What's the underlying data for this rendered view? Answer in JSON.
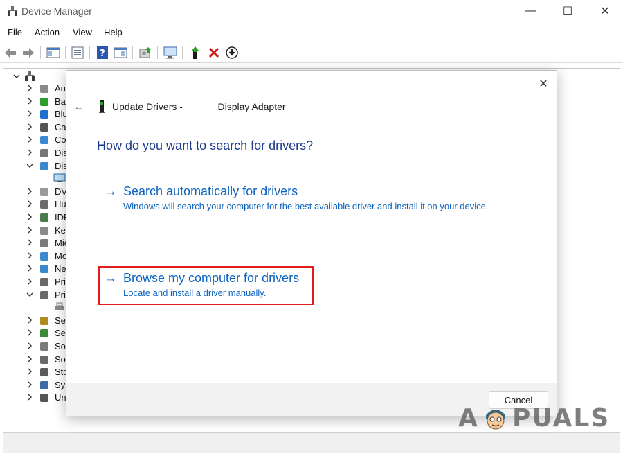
{
  "window": {
    "title": "Device Manager",
    "minimize_glyph": "—",
    "maximize_glyph": "☐",
    "close_glyph": "✕"
  },
  "menu": {
    "items": [
      "File",
      "Action",
      "View",
      "Help"
    ]
  },
  "toolbar": {
    "icons": [
      "back-arrow-icon",
      "forward-arrow-icon",
      "show-hide-console-tree-icon",
      "properties-icon",
      "help-icon",
      "action-pane-icon",
      "update-driver-icon",
      "scan-hardware-icon",
      "add-driver-icon",
      "uninstall-icon",
      "download-icon"
    ]
  },
  "tree": {
    "items": [
      {
        "label": "Au",
        "icon": "audio-icon",
        "expanded": false
      },
      {
        "label": "Ba",
        "icon": "battery-icon",
        "expanded": false
      },
      {
        "label": "Blu",
        "icon": "bluetooth-icon",
        "expanded": false
      },
      {
        "label": "Ca",
        "icon": "camera-icon",
        "expanded": false
      },
      {
        "label": "Co",
        "icon": "computer-icon",
        "expanded": false
      },
      {
        "label": "Dis",
        "icon": "disk-drive-icon",
        "expanded": false
      },
      {
        "label": "Dis",
        "icon": "display-adapter-icon",
        "expanded": true
      },
      {
        "label": "DV",
        "icon": "dvd-icon",
        "expanded": false
      },
      {
        "label": "Hu",
        "icon": "hid-icon",
        "expanded": false
      },
      {
        "label": "IDE",
        "icon": "ide-icon",
        "expanded": false
      },
      {
        "label": "Ke",
        "icon": "keyboard-icon",
        "expanded": false
      },
      {
        "label": "Mic",
        "icon": "mouse-icon",
        "expanded": false
      },
      {
        "label": "Mo",
        "icon": "monitor-icon",
        "expanded": false
      },
      {
        "label": "Ne",
        "icon": "network-icon",
        "expanded": false
      },
      {
        "label": "Pri",
        "icon": "print-queue-icon",
        "expanded": false
      },
      {
        "label": "Pri",
        "icon": "printer-icon",
        "expanded": true
      },
      {
        "label": "Se",
        "icon": "security-device-icon",
        "expanded": false
      },
      {
        "label": "Se",
        "icon": "sensor-icon",
        "expanded": false
      },
      {
        "label": "So",
        "icon": "software-component-icon",
        "expanded": false
      },
      {
        "label": "So",
        "icon": "sound-icon",
        "expanded": false
      },
      {
        "label": "Sto",
        "icon": "storage-icon",
        "expanded": false
      },
      {
        "label": "Sy",
        "icon": "system-device-icon",
        "expanded": false
      },
      {
        "label": "Un",
        "icon": "usb-icon",
        "expanded": false
      }
    ]
  },
  "dialog": {
    "title_prefix": "Update Drivers -",
    "title_device": "Display Adapter",
    "question": "How do you want to search for drivers?",
    "option_auto": {
      "title": "Search automatically for drivers",
      "description": "Windows will search your computer for the best available driver and install it on your device."
    },
    "option_browse": {
      "title": "Browse my computer for drivers",
      "description": "Locate and install a driver manually."
    },
    "arrow_glyph": "→",
    "back_glyph": "←",
    "close_glyph": "✕",
    "cancel_label": "Cancel"
  },
  "watermark": {
    "text_left": "A",
    "text_right": "PUALS"
  },
  "colors": {
    "link_blue": "#0c64c0",
    "heading_blue": "#1b3a8c",
    "highlight_red": "#e21b1b"
  }
}
